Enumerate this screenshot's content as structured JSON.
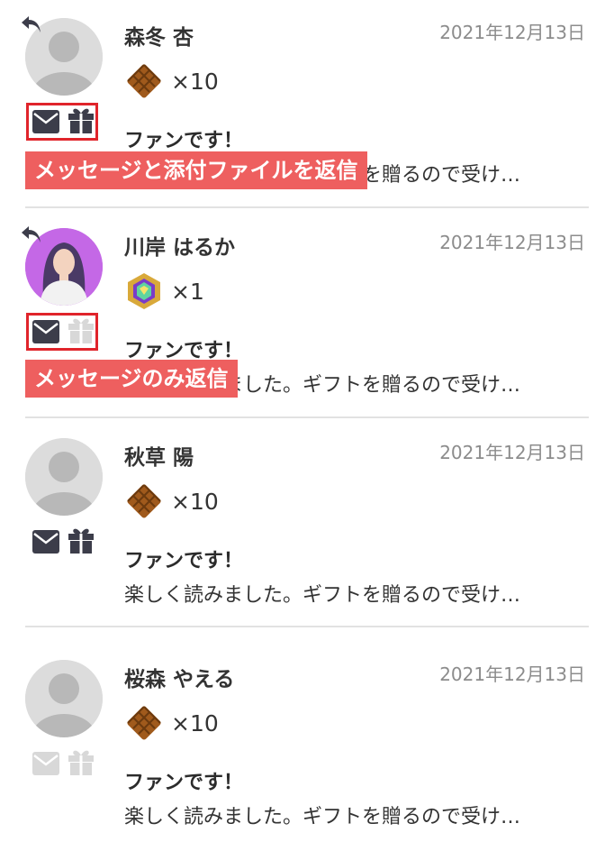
{
  "colors": {
    "icon_active": "#3c3d4a",
    "icon_disabled": "#d8d8d8",
    "highlight_border": "#e0242b",
    "overlay_bg": "#ee5f5f",
    "date_text": "#8c8c8c"
  },
  "items": [
    {
      "name": "森冬 杏",
      "date": "2021年12月13日",
      "gift_icon": "waffle",
      "count": "×10",
      "message_title": "ファンです！",
      "message_preview": "楽しく読みました。ギフトを贈るので受け…",
      "has_reply_icon": true,
      "mail_enabled": true,
      "gift_enabled": true,
      "overlay_label": "メッセージと添付ファイルを返信"
    },
    {
      "name": "川岸 はるか",
      "date": "2021年12月13日",
      "gift_icon": "gem",
      "count": "×1",
      "message_title": "ファンです！",
      "message_preview": "楽しく読みました。ギフトを贈るので受け…",
      "has_reply_icon": true,
      "mail_enabled": true,
      "gift_enabled": false,
      "overlay_label": "メッセージのみ返信"
    },
    {
      "name": "秋草 陽",
      "date": "2021年12月13日",
      "gift_icon": "waffle",
      "count": "×10",
      "message_title": "ファンです！",
      "message_preview": "楽しく読みました。ギフトを贈るので受け…",
      "has_reply_icon": false,
      "mail_enabled": true,
      "gift_enabled": true
    },
    {
      "name": "桜森 やえる",
      "date": "2021年12月13日",
      "gift_icon": "waffle",
      "count": "×10",
      "message_title": "ファンです！",
      "message_preview": "楽しく読みました。ギフトを贈るので受け…",
      "has_reply_icon": false,
      "mail_enabled": false,
      "gift_enabled": false
    }
  ]
}
